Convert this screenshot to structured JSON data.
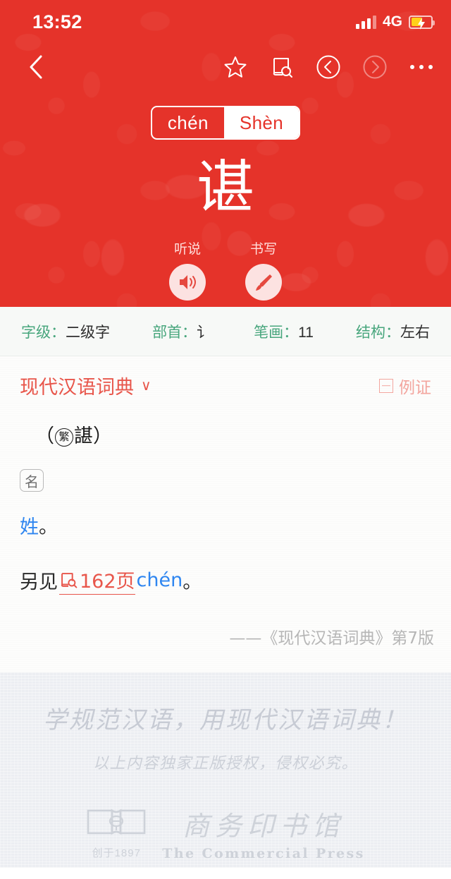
{
  "status_bar": {
    "time": "13:52",
    "network": "4G",
    "signal_icon": "signal-bars-icon",
    "battery_icon": "battery-charging-icon"
  },
  "nav_bar": {
    "back_icon": "chevron-left-icon",
    "favorite_icon": "star-icon",
    "book_search_icon": "book-search-icon",
    "prev_icon": "circle-chevron-left-icon",
    "next_icon": "circle-chevron-right-icon",
    "more_icon": "more-dots-icon"
  },
  "pinyin_toggle": {
    "options": [
      {
        "label": "chén",
        "selected": false
      },
      {
        "label": "Shèn",
        "selected": true
      }
    ]
  },
  "headword": {
    "character": "谌"
  },
  "actions": [
    {
      "label": "听说",
      "icon": "speaker-icon"
    },
    {
      "label": "书写",
      "icon": "brush-icon"
    }
  ],
  "info_bar": [
    {
      "label": "字级：",
      "value": "二级字"
    },
    {
      "label": "部首：",
      "value": "讠"
    },
    {
      "label": "笔画：",
      "value": "11"
    },
    {
      "label": "结构：",
      "value": "左右"
    }
  ],
  "dictionary": {
    "name": "现代汉语词典",
    "chevron": "∨",
    "examples_label": "例证",
    "examples_icon": "collapse-box-icon"
  },
  "definition": {
    "traditional": {
      "open_paren": "（",
      "marker": "繁",
      "form": "諶",
      "close_paren": "）"
    },
    "pos_tag": "名",
    "sense_text": "姓",
    "sense_period": "。",
    "see_also": {
      "prefix": "另见",
      "page_icon": "book-search-icon",
      "page": "162页",
      "pinyin": "chén",
      "period": "。"
    },
    "source": "——《现代汉语词典》第7版"
  },
  "footer": {
    "slogan": "学规范汉语，用现代汉语词典！",
    "sub_slogan": "以上内容独家正版授权，侵权必究。",
    "publisher": {
      "founded": "创于1897",
      "name_cn": "商务印书馆",
      "name_en": "The Commercial Press",
      "logo_icon": "open-book-logo-icon"
    }
  },
  "colors": {
    "brand_red": "#e5332a",
    "link_red": "#e8564b",
    "link_blue": "#2f86f0",
    "info_green": "#48a67d"
  }
}
